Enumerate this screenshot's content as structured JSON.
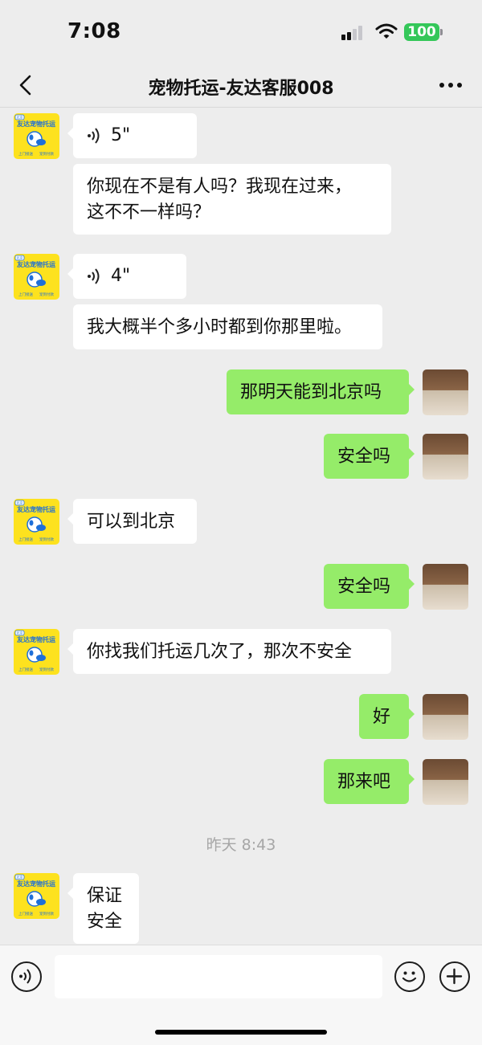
{
  "status": {
    "time": "7:08",
    "battery": "100"
  },
  "nav": {
    "title": "宠物托运-友达客服008"
  },
  "avatar": {
    "badge": "北京",
    "name_chars": "友达宠物托运",
    "slogan_left": "上门接送",
    "slogan_right": "宠到付款"
  },
  "messages": [
    {
      "side": "left",
      "type": "voice",
      "duration": "5\""
    },
    {
      "side": "left",
      "type": "text",
      "lines": [
        "你现在不是有人吗？我现在过来，",
        "这不不一样吗？"
      ]
    },
    {
      "side": "left",
      "type": "voice",
      "duration": "4\""
    },
    {
      "side": "left",
      "type": "text",
      "lines": [
        "我大概半个多小时都到你那里啦。"
      ]
    },
    {
      "side": "right",
      "type": "text",
      "lines": [
        "那明天能到北京吗"
      ]
    },
    {
      "side": "right",
      "type": "text",
      "lines": [
        "安全吗"
      ]
    },
    {
      "side": "left",
      "type": "text",
      "lines": [
        "可以到北京"
      ]
    },
    {
      "side": "right",
      "type": "text",
      "lines": [
        "安全吗"
      ]
    },
    {
      "side": "left",
      "type": "text",
      "lines": [
        "你找我们托运几次了，那次不安全"
      ]
    },
    {
      "side": "right",
      "type": "text",
      "lines": [
        "好"
      ]
    },
    {
      "side": "right",
      "type": "text",
      "lines": [
        "那来吧"
      ]
    },
    {
      "side": "left",
      "type": "text",
      "lines": [
        "保证",
        "安全"
      ]
    }
  ],
  "timestamp": "昨天 8:43",
  "colors": {
    "sent_bubble": "#95ec69",
    "received_bubble": "#ffffff",
    "background": "#ededed",
    "avatar_yellow": "#fde21e",
    "avatar_blue": "#1e6fd9"
  }
}
